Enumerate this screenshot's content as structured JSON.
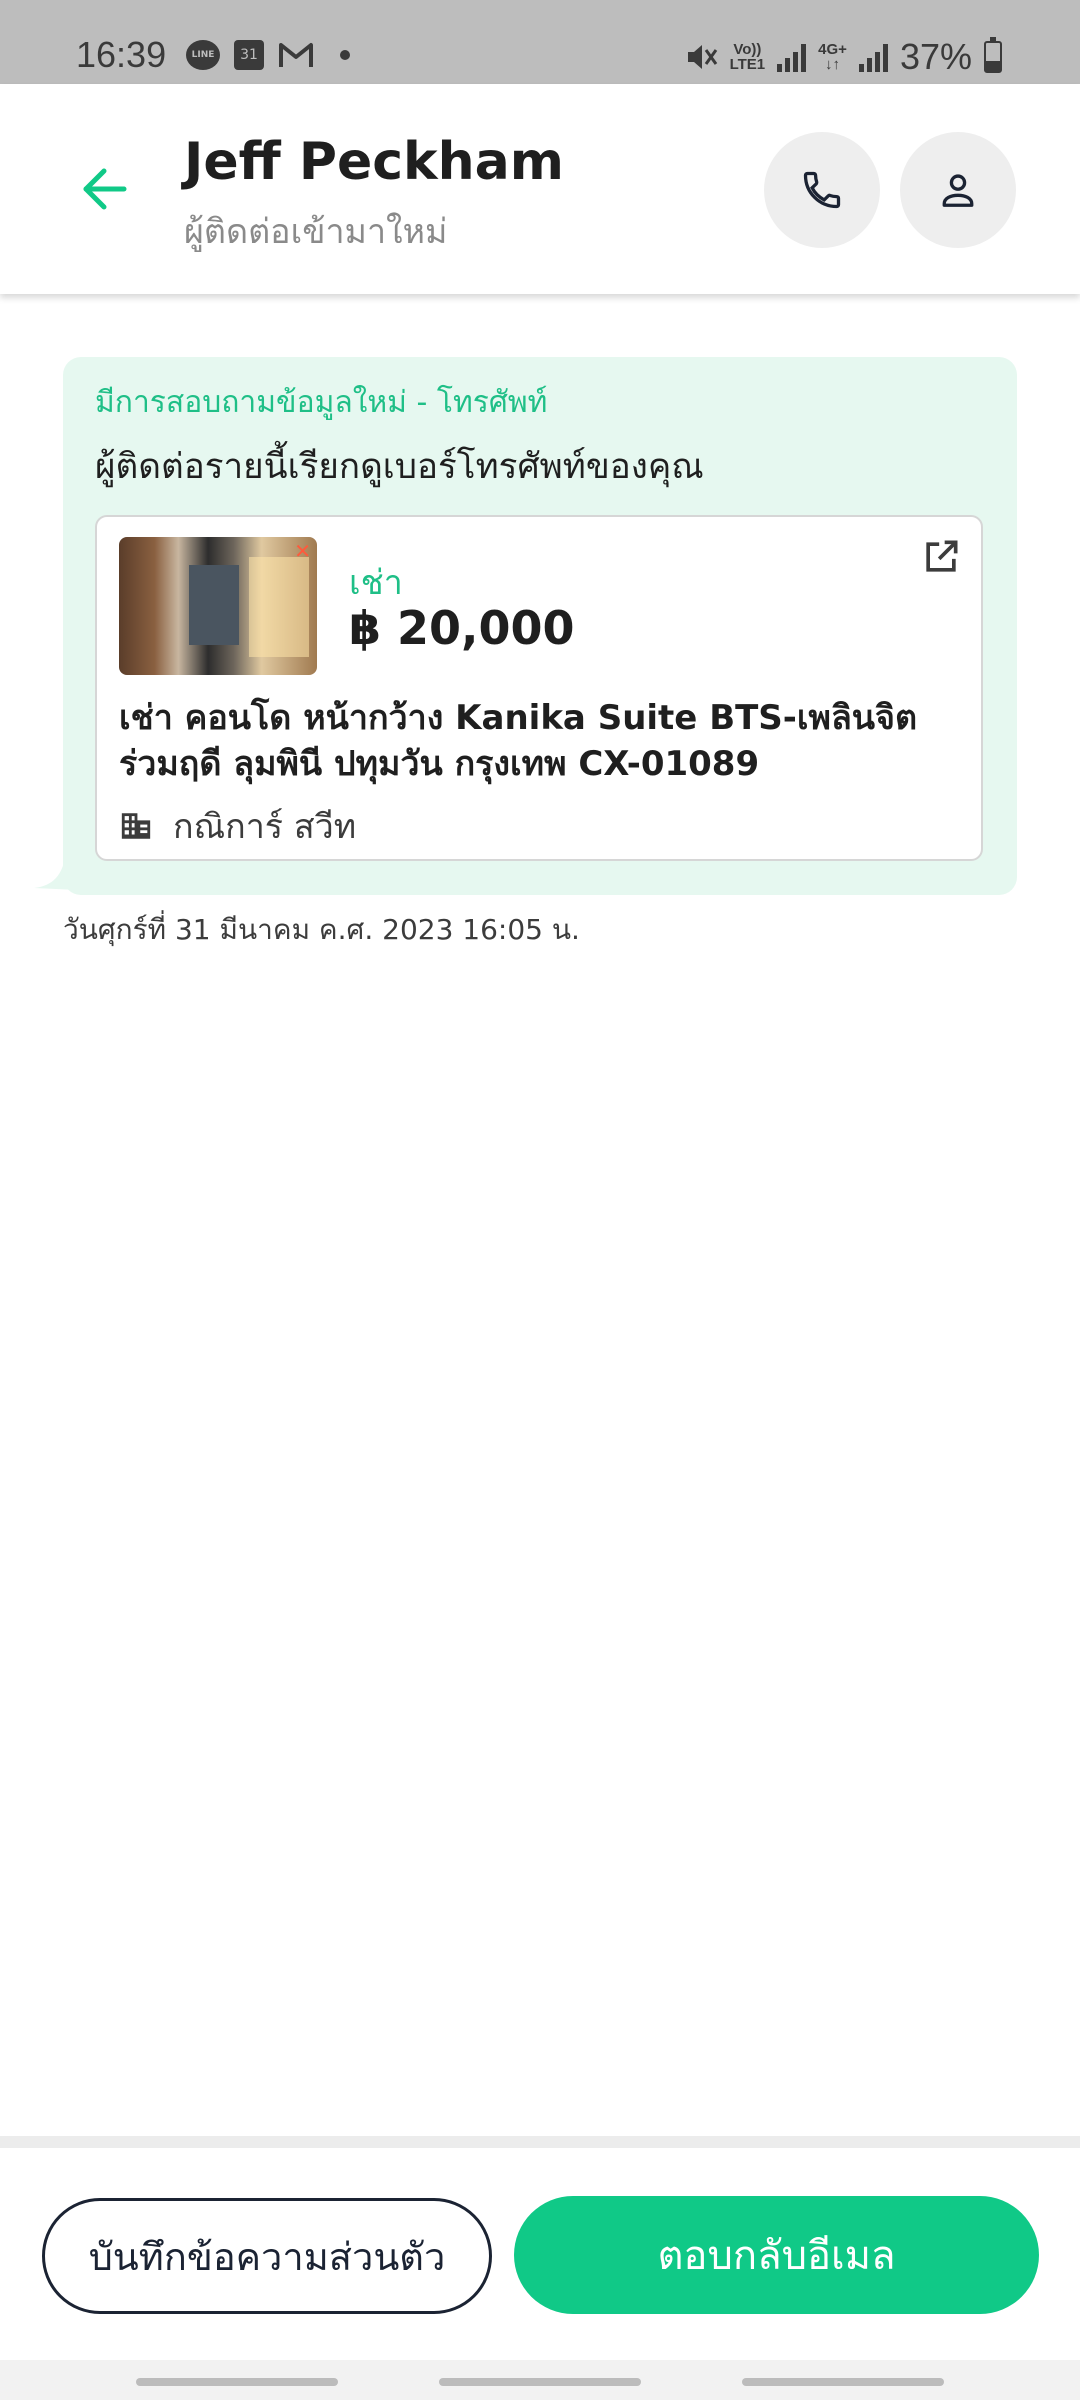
{
  "status_bar": {
    "time": "16:39",
    "calendar_day": "31",
    "icons_left": [
      "line-icon",
      "calendar-icon",
      "gmail-icon",
      "dot-icon"
    ],
    "volte_label_top": "Vo))",
    "volte_label_bottom": "LTE1",
    "network_label_top": "4G+",
    "network_label_bottom": "↓↑",
    "battery_percent": "37%",
    "battery_level": 0.37
  },
  "header": {
    "contact_name": "Jeff Peckham",
    "contact_subtitle": "ผู้ติดต่อเข้ามาใหม่",
    "back_icon": "arrow-left-icon",
    "call_icon": "phone-icon",
    "profile_icon": "person-icon"
  },
  "message": {
    "type_label": "มีการสอบถามข้อมูลใหม่ - โทรศัพท์",
    "text": "ผู้ติดต่อรายนี้เรียกดูเบอร์โทรศัพท์ของคุณ",
    "timestamp": "วันศุกร์ที่ 31 มีนาคม ค.ศ. 2023 16:05 น.",
    "listing": {
      "listing_type": "เช่า",
      "price": "฿ 20,000",
      "title": "เช่า คอนโด หน้ากว้าง Kanika Suite BTS-เพลินจิต ร่วมฤดี ลุมพินี ปทุมวัน กรุงเทพ CX-01089",
      "project_name": "กณิการ์ สวีท",
      "thumb_badge": "✕"
    }
  },
  "actions": {
    "private_note_label": "บันทึกข้อความส่วนตัว",
    "reply_email_label": "ตอบกลับอีเมล"
  },
  "colors": {
    "accent_green": "#10c987",
    "bubble_bg": "#e6f8f0",
    "dark_navy": "#1b2333",
    "status_bar_bg": "#bdbdbd"
  }
}
